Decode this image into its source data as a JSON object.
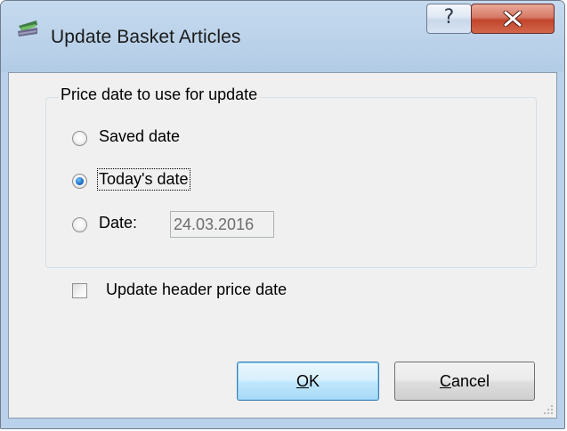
{
  "window": {
    "title": "Update Basket Articles",
    "help_label": "?",
    "close_icon": "close-icon"
  },
  "group": {
    "legend": "Price date to use for update",
    "options": [
      {
        "label": "Saved date",
        "checked": false
      },
      {
        "label": "Today's date",
        "checked": true
      },
      {
        "label": "Date:",
        "checked": false
      }
    ],
    "date_value": "24.03.2016"
  },
  "checkbox": {
    "label": "Update header price date",
    "checked": false
  },
  "buttons": {
    "ok_mnemonic": "O",
    "ok_rest": "K",
    "cancel_mnemonic": "C",
    "cancel_rest": "ancel"
  },
  "colors": {
    "title_bar": "#bcd3ea",
    "close_button": "#c2452b",
    "radio_selected": "#1d72c8",
    "dialog_face": "#f0f0f0"
  }
}
